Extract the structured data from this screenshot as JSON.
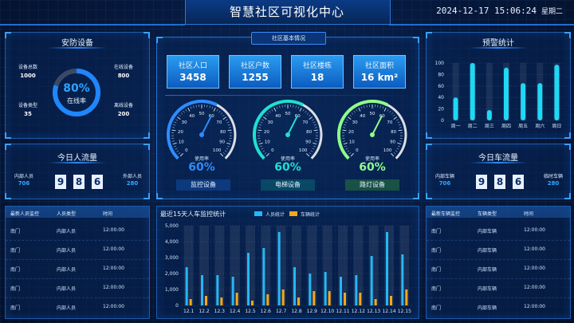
{
  "header": {
    "title": "智慧社区可视化中心",
    "datetime": "2024-12-17 15:06:24",
    "weekday": "星期二"
  },
  "security": {
    "title": "安防设备",
    "total_label": "设备总数",
    "total_value": "1000",
    "type_label": "设备类型",
    "type_value": "35",
    "online_label": "在线设备",
    "online_value": "800",
    "offline_label": "离线设备",
    "offline_value": "200",
    "rate_value": "80%",
    "rate_label": "在线率",
    "rate_fraction": 0.8
  },
  "people_flow": {
    "title": "今日人流量",
    "internal_label": "内部人员",
    "internal_value": "706",
    "external_label": "外部人员",
    "external_value": "280",
    "digits": [
      "9",
      "8",
      "6"
    ]
  },
  "people_table": {
    "headers": [
      "最新人员监控",
      "人员类型",
      "时间"
    ],
    "rows": [
      [
        "南门",
        "内部人员",
        "12:00:00"
      ],
      [
        "南门",
        "内部人员",
        "12:00:00"
      ],
      [
        "南门",
        "内部人员",
        "12:00:00"
      ],
      [
        "南门",
        "内部人员",
        "12:00:00"
      ],
      [
        "南门",
        "内部人员",
        "12:00:00"
      ]
    ]
  },
  "community": {
    "panel_label": "社区基本情况",
    "cards": [
      {
        "label": "社区人口",
        "value": "3458"
      },
      {
        "label": "社区户数",
        "value": "1255"
      },
      {
        "label": "社区楼栋",
        "value": "18"
      },
      {
        "label": "社区面积",
        "value": "16 km²"
      }
    ],
    "gauges": [
      {
        "pct": "60%",
        "sub": "使用率",
        "button": "监控设备",
        "color": "#2f8cff",
        "value": 60
      },
      {
        "pct": "60%",
        "sub": "使用率",
        "button": "电梯设备",
        "color": "#1fe0d0",
        "value": 60
      },
      {
        "pct": "60%",
        "sub": "使用率",
        "button": "路灯设备",
        "color": "#8fff8a",
        "value": 60
      }
    ],
    "gauge_ticks": [
      "0",
      "10",
      "20",
      "30",
      "40",
      "50",
      "60",
      "70",
      "80",
      "90",
      "100"
    ]
  },
  "chart_data": [
    {
      "type": "bar",
      "title": "最近15天人车监控统计",
      "categories": [
        "12.1",
        "12.2",
        "12.3",
        "12.4",
        "12.5",
        "12.6",
        "12.7",
        "12.8",
        "12.9",
        "12.10",
        "12.11",
        "12.12",
        "12.13",
        "12.14",
        "12.15"
      ],
      "series": [
        {
          "name": "人员统计",
          "values": [
            2400,
            1900,
            1900,
            1800,
            3300,
            3600,
            4600,
            2400,
            2000,
            2100,
            1800,
            1900,
            3100,
            4600,
            3200
          ],
          "color": "#25b7f5"
        },
        {
          "name": "车辆统计",
          "values": [
            400,
            600,
            500,
            800,
            300,
            700,
            1000,
            500,
            900,
            900,
            800,
            800,
            400,
            600,
            1000
          ],
          "color": "#f5a71b"
        }
      ],
      "yticks": [
        "0",
        "1,000",
        "2,000",
        "3,000",
        "4,000",
        "5,000"
      ],
      "ylim": [
        0,
        5000
      ],
      "legend_position": "top"
    },
    {
      "type": "bar",
      "title": "预警统计",
      "categories": [
        "周一",
        "周二",
        "周三",
        "周四",
        "周五",
        "周六",
        "周日"
      ],
      "values": [
        40,
        100,
        18,
        92,
        65,
        65,
        97
      ],
      "yticks": [
        "0",
        "20",
        "40",
        "60",
        "80",
        "100"
      ],
      "ylim": [
        0,
        100
      ]
    }
  ],
  "vehicle_flow": {
    "title": "今日车流量",
    "internal_label": "内部车辆",
    "internal_value": "706",
    "temp_label": "临时车辆",
    "temp_value": "280",
    "digits": [
      "9",
      "8",
      "6"
    ]
  },
  "vehicle_table": {
    "headers": [
      "最新车辆监控",
      "车辆类型",
      "时间"
    ],
    "rows": [
      [
        "南门",
        "内部车辆",
        "12:00:00"
      ],
      [
        "南门",
        "内部车辆",
        "12:00:00"
      ],
      [
        "南门",
        "内部车辆",
        "12:00:00"
      ],
      [
        "南门",
        "内部车辆",
        "12:00:00"
      ],
      [
        "南门",
        "内部车辆",
        "12:00:00"
      ]
    ]
  }
}
